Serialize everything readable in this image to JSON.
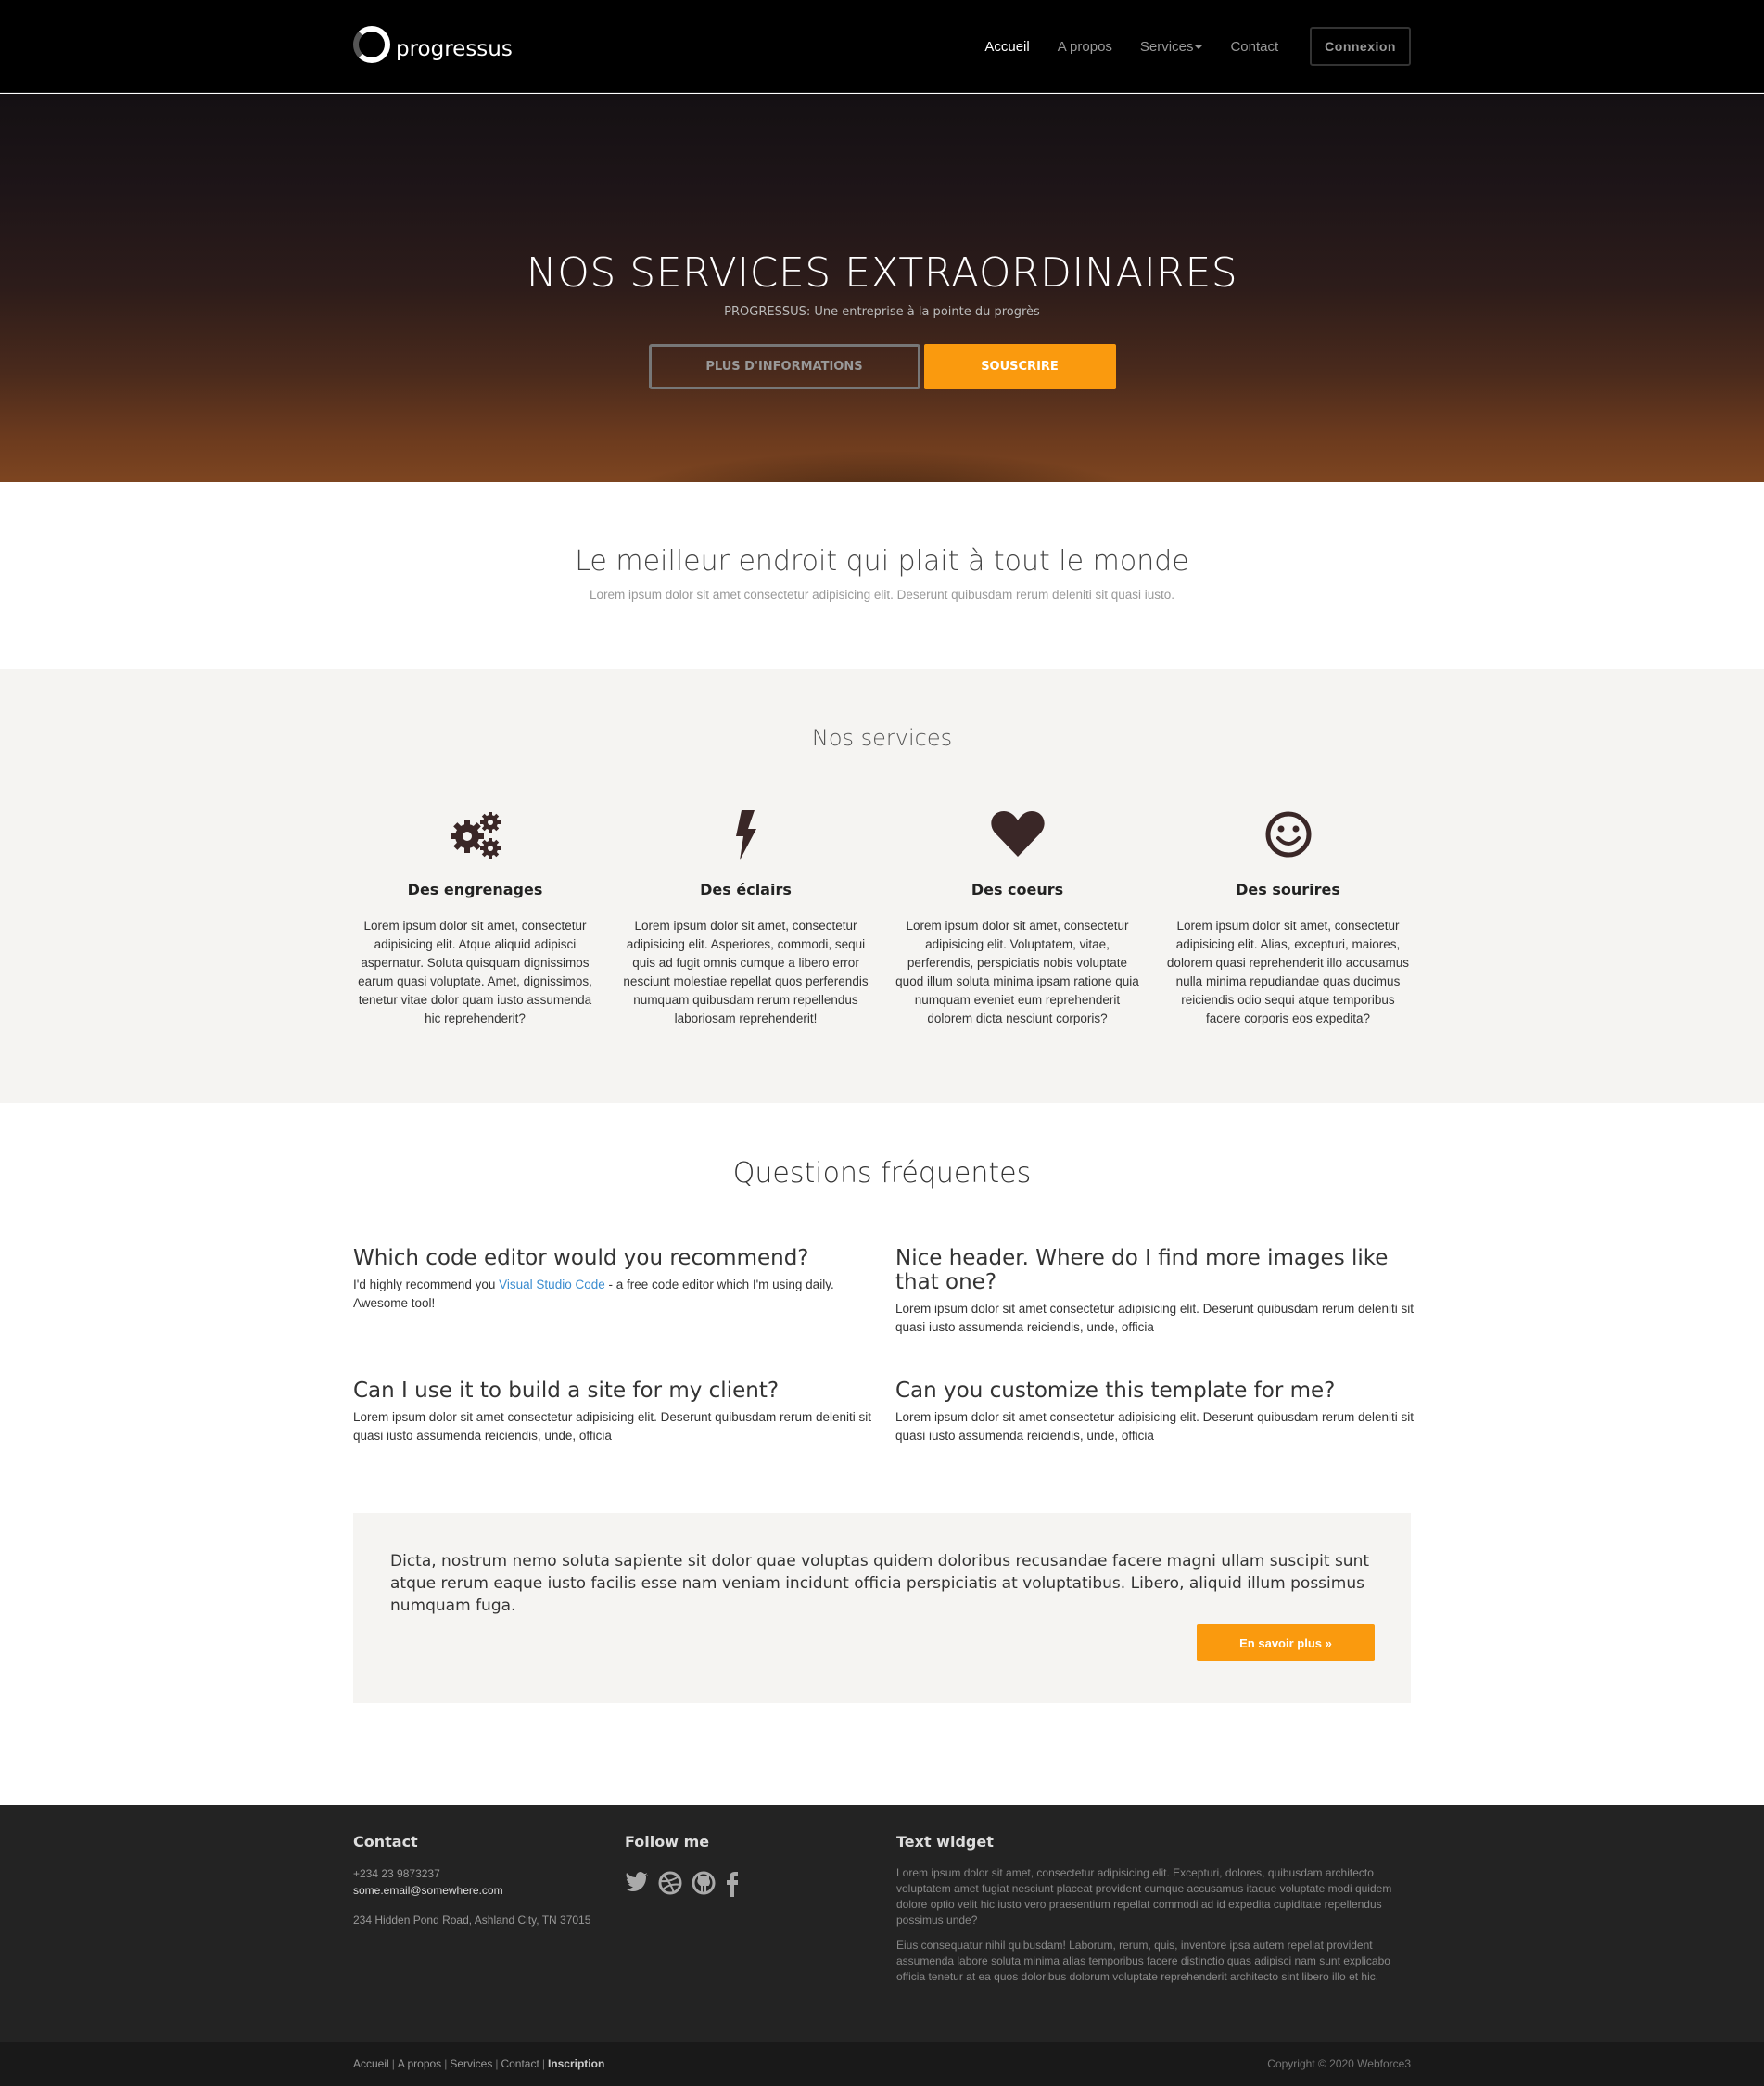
{
  "brand": {
    "name": "progressus"
  },
  "nav": {
    "items": [
      "Accueil",
      "A propos",
      "Services",
      "Contact"
    ],
    "login": "Connexion"
  },
  "hero": {
    "title": "NOS SERVICES EXTRAORDINAIRES",
    "subtitle": "PROGRESSUS: Une entreprise à la pointe du progrès",
    "btn_info": "PLUS D'INFORMATIONS",
    "btn_subscribe": "SOUSCRIRE"
  },
  "lead": {
    "title": "Le meilleur endroit qui plait à tout le monde",
    "text": "Lorem ipsum dolor sit amet consectetur adipisicing elit. Deserunt quibusdam rerum deleniti sit quasi iusto."
  },
  "services": {
    "title": "Nos services",
    "items": [
      {
        "icon": "gears-icon",
        "title": "Des engrenages",
        "text": "Lorem ipsum dolor sit amet, consectetur adipisicing elit. Atque aliquid adipisci aspernatur. Soluta quisquam dignissimos earum quasi voluptate. Amet, dignissimos, tenetur vitae dolor quam iusto assumenda hic reprehenderit?"
      },
      {
        "icon": "lightning-icon",
        "title": "Des éclairs",
        "text": "Lorem ipsum dolor sit amet, consectetur adipisicing elit. Asperiores, commodi, sequi quis ad fugit omnis cumque a libero error nesciunt molestiae repellat quos perferendis numquam quibusdam rerum repellendus laboriosam reprehenderit!"
      },
      {
        "icon": "heart-icon",
        "title": "Des coeurs",
        "text": "Lorem ipsum dolor sit amet, consectetur adipisicing elit. Voluptatem, vitae, perferendis, perspiciatis nobis voluptate quod illum soluta minima ipsam ratione quia numquam eveniet eum reprehenderit dolorem dicta nesciunt corporis?"
      },
      {
        "icon": "smiley-icon",
        "title": "Des sourires",
        "text": "Lorem ipsum dolor sit amet, consectetur adipisicing elit. Alias, excepturi, maiores, dolorem quasi reprehenderit illo accusamus nulla minima repudiandae quas ducimus reiciendis odio sequi atque temporibus facere corporis eos expedita?"
      }
    ]
  },
  "faq": {
    "title": "Questions fréquentes",
    "items": [
      {
        "q": "Which code editor would you recommend?",
        "a_before": "I'd highly recommend you ",
        "a_link": "Visual Studio Code",
        "a_after": " - a free code editor which I'm using daily. Awesome tool!"
      },
      {
        "q": "Nice header. Where do I find more images like that one?",
        "a": "Lorem ipsum dolor sit amet consectetur adipisicing elit. Deserunt quibusdam rerum deleniti sit quasi iusto assumenda reiciendis, unde, officia"
      },
      {
        "q": "Can I use it to build a site for my client?",
        "a": "Lorem ipsum dolor sit amet consectetur adipisicing elit. Deserunt quibusdam rerum deleniti sit quasi iusto assumenda reiciendis, unde, officia"
      },
      {
        "q": "Can you customize this template for me?",
        "a": "Lorem ipsum dolor sit amet consectetur adipisicing elit. Deserunt quibusdam rerum deleniti sit quasi iusto assumenda reiciendis, unde, officia"
      }
    ]
  },
  "callout": {
    "text": "Dicta, nostrum nemo soluta sapiente sit dolor quae voluptas quidem doloribus recusandae facere magni ullam suscipit sunt atque rerum eaque iusto facilis esse nam veniam incidunt officia perspiciatis at voluptatibus. Libero, aliquid illum possimus numquam fuga.",
    "button": "En savoir plus »"
  },
  "footer": {
    "contact_title": "Contact",
    "phone": "+234 23 9873237",
    "email": "some.email@somewhere.com",
    "address": "234 Hidden Pond Road, Ashland City, TN 37015",
    "follow_title": "Follow me",
    "social": [
      "twitter-icon",
      "dribbble-icon",
      "github-icon",
      "facebook-icon"
    ],
    "widget_title": "Text widget",
    "widget_p1": "Lorem ipsum dolor sit amet, consectetur adipisicing elit. Excepturi, dolores, quibusdam architecto voluptatem amet fugiat nesciunt placeat provident cumque accusamus itaque voluptate modi quidem dolore optio velit hic iusto vero praesentium repellat commodi ad id expedita cupiditate repellendus possimus unde?",
    "widget_p2": "Eius consequatur nihil quibusdam! Laborum, rerum, quis, inventore ipsa autem repellat provident assumenda labore soluta minima alias temporibus facere distinctio quas adipisci nam sunt explicabo officia tenetur at ea quos doloribus dolorum voluptate reprehenderit architecto sint libero illo et hic.",
    "links": [
      "Accueil",
      "A propos",
      "Services",
      "Contact"
    ],
    "link_bold": "Inscription",
    "copyright": "Copyright © 2020 Webforce3"
  },
  "colors": {
    "accent": "#fa9a0e",
    "link": "#3a8ccf",
    "footer_bg": "#232323"
  }
}
